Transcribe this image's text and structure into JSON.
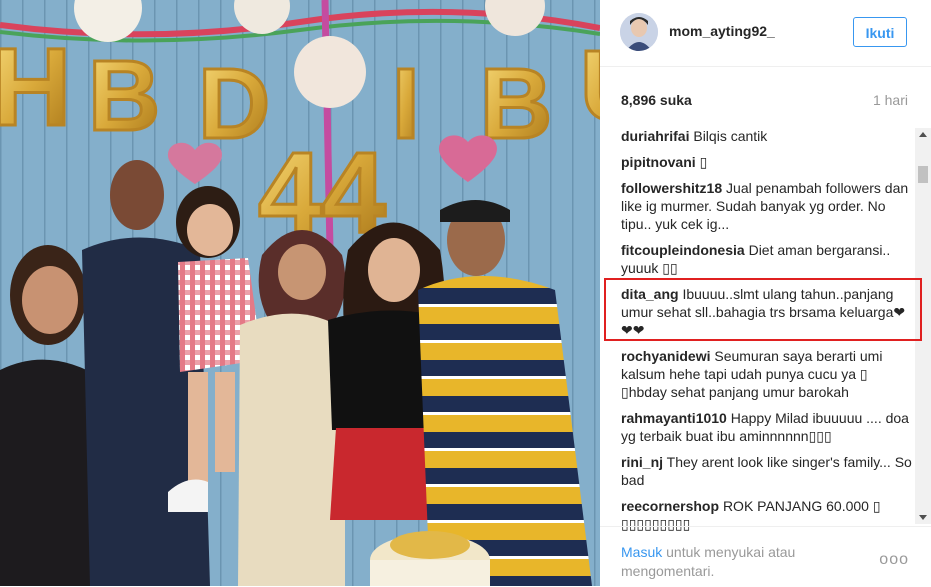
{
  "header": {
    "username": "mom_ayting92_",
    "follow_label": "Ikuti"
  },
  "meta": {
    "likes": "8,896 suka",
    "time_ago": "1 hari"
  },
  "photo": {
    "balloon_letters": [
      "H",
      "B",
      "D",
      "I",
      "B",
      "U"
    ],
    "balloon_number": "44"
  },
  "comments": [
    {
      "user": "duriahrifai",
      "text": "Bilqis cantik"
    },
    {
      "user": "pipitnovani",
      "text": "▯"
    },
    {
      "user": "followershitz18",
      "text": "Jual penambah followers dan like ig murmer. Sudah banyak yg order. No tipu.. yuk cek ig..."
    },
    {
      "user": "fitcoupleindonesia",
      "text": "Diet aman bergaransi.. yuuuk ▯▯"
    },
    {
      "user": "dita_ang",
      "text": "Ibuuuu..slmt ulang tahun..panjang umur sehat sll..bahagia trs brsama keluarga❤❤❤"
    },
    {
      "user": "rochyanidewi",
      "text": "Seumuran saya berarti umi kalsum hehe tapi udah punya cucu ya ▯ ▯hbday sehat panjang umur barokah"
    },
    {
      "user": "rahmayanti1010",
      "text": "Happy Milad ibuuuuu .... doa yg terbaik buat ibu aminnnnnn▯▯▯"
    },
    {
      "user": "rini_nj",
      "text": "They arent look like singer's family... So bad"
    },
    {
      "user": "reecornershop",
      "text": "ROK PANJANG 60.000 ▯ ▯▯▯▯▯▯▯▯▯"
    }
  ],
  "footer": {
    "login_link": "Masuk",
    "login_text": "untuk menyukai atau mengomentari.",
    "more_label": "ooo"
  },
  "colors": {
    "link_blue": "#3897f0",
    "highlight_red": "#e02020"
  }
}
